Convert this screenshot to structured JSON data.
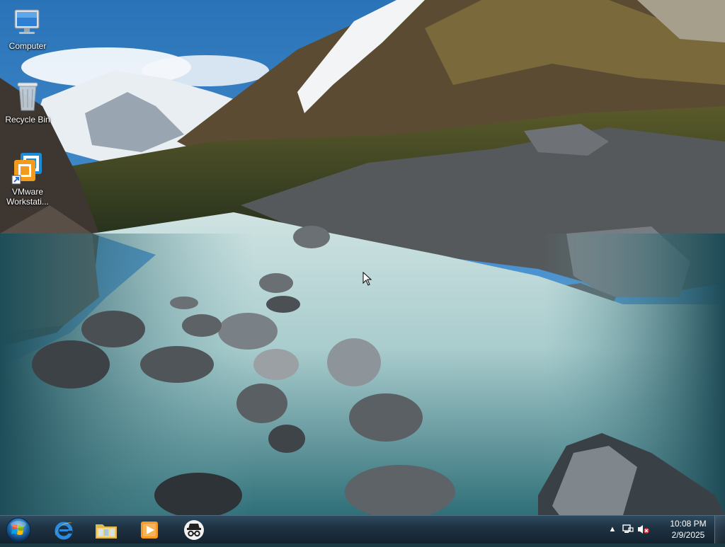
{
  "desktop": {
    "icons": [
      {
        "label": "Computer",
        "icon": "computer-icon"
      },
      {
        "label": "Recycle Bin",
        "icon": "recycle-bin-icon"
      },
      {
        "label": "VMware Workstati...",
        "icon": "vmware-workstation-icon"
      }
    ],
    "wallpaper": "mountain-river-landscape"
  },
  "taskbar": {
    "start": {
      "icon": "windows-start-orb"
    },
    "pinned": [
      {
        "icon": "internet-explorer-icon"
      },
      {
        "icon": "file-explorer-icon"
      },
      {
        "icon": "media-player-icon"
      },
      {
        "icon": "incognito-icon"
      }
    ],
    "tray": {
      "icons": [
        "show-hidden-icons-arrow",
        "network-icon",
        "volume-muted-icon"
      ],
      "time": "10:08 PM",
      "date": "2/9/2025"
    }
  },
  "colors": {
    "taskbar": "#1d3142",
    "sky": "#2f7fc4",
    "water": "#b9d6d8"
  }
}
